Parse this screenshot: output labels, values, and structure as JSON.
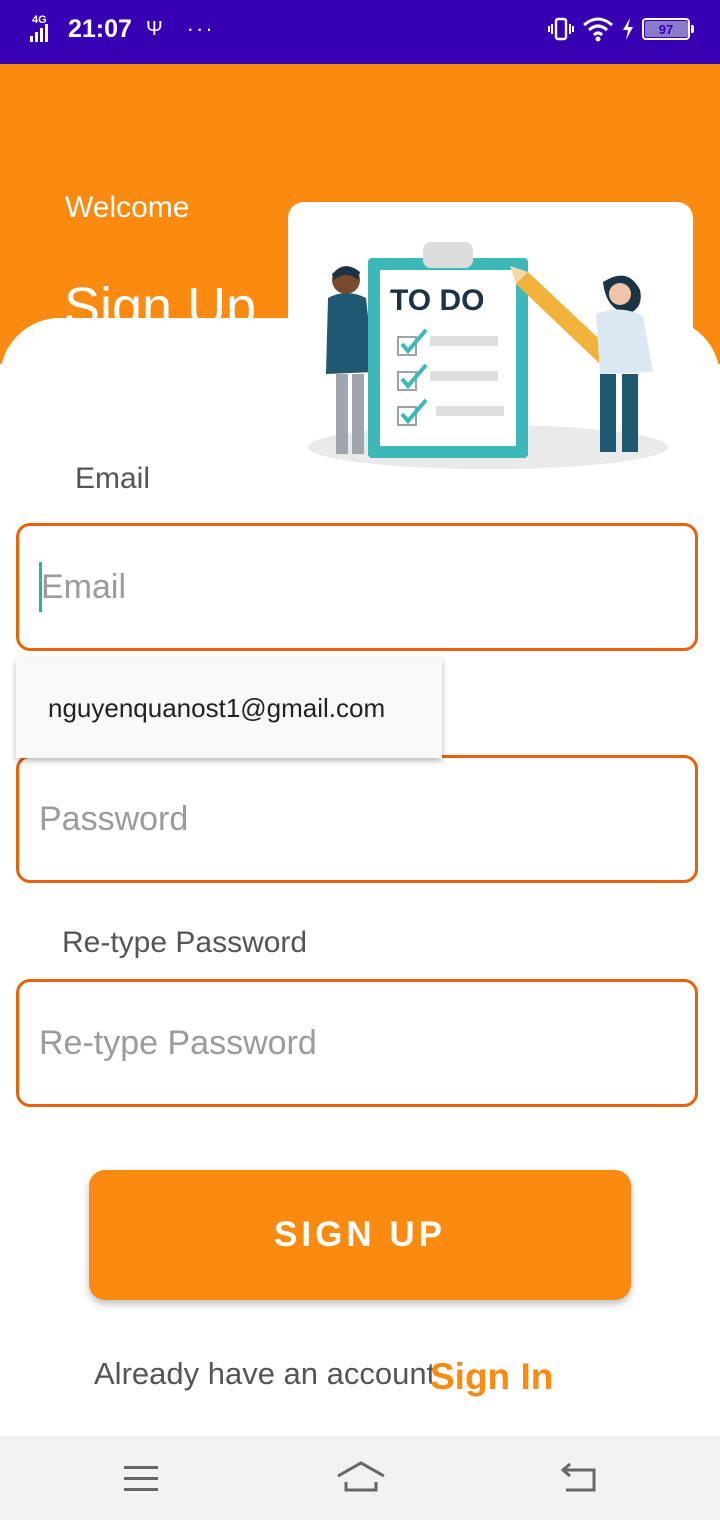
{
  "status_bar": {
    "network": "4G",
    "time": "21:07",
    "battery": "97",
    "battery_level": 0.97
  },
  "header": {
    "welcome": "Welcome",
    "title": "Sign Up",
    "illustration_text": "TO DO"
  },
  "form": {
    "email_label": "Email",
    "email_placeholder": "Email",
    "autocomplete_suggestion": "nguyenquanost1@gmail.com",
    "password_placeholder": "Password",
    "retype_label": "Re-type Password",
    "retype_placeholder": "Re-type Password"
  },
  "actions": {
    "signup_button": "SIGN UP",
    "already_text": "Already have an account",
    "signin_link": "Sign In"
  },
  "colors": {
    "status_bar": "#3700b3",
    "accent": "#fb8a10",
    "field_border": "#e8620b",
    "caret": "#1fb5a8"
  },
  "icons": {
    "nav_menu": "menu-icon",
    "nav_home": "home-icon",
    "nav_back": "back-icon"
  }
}
